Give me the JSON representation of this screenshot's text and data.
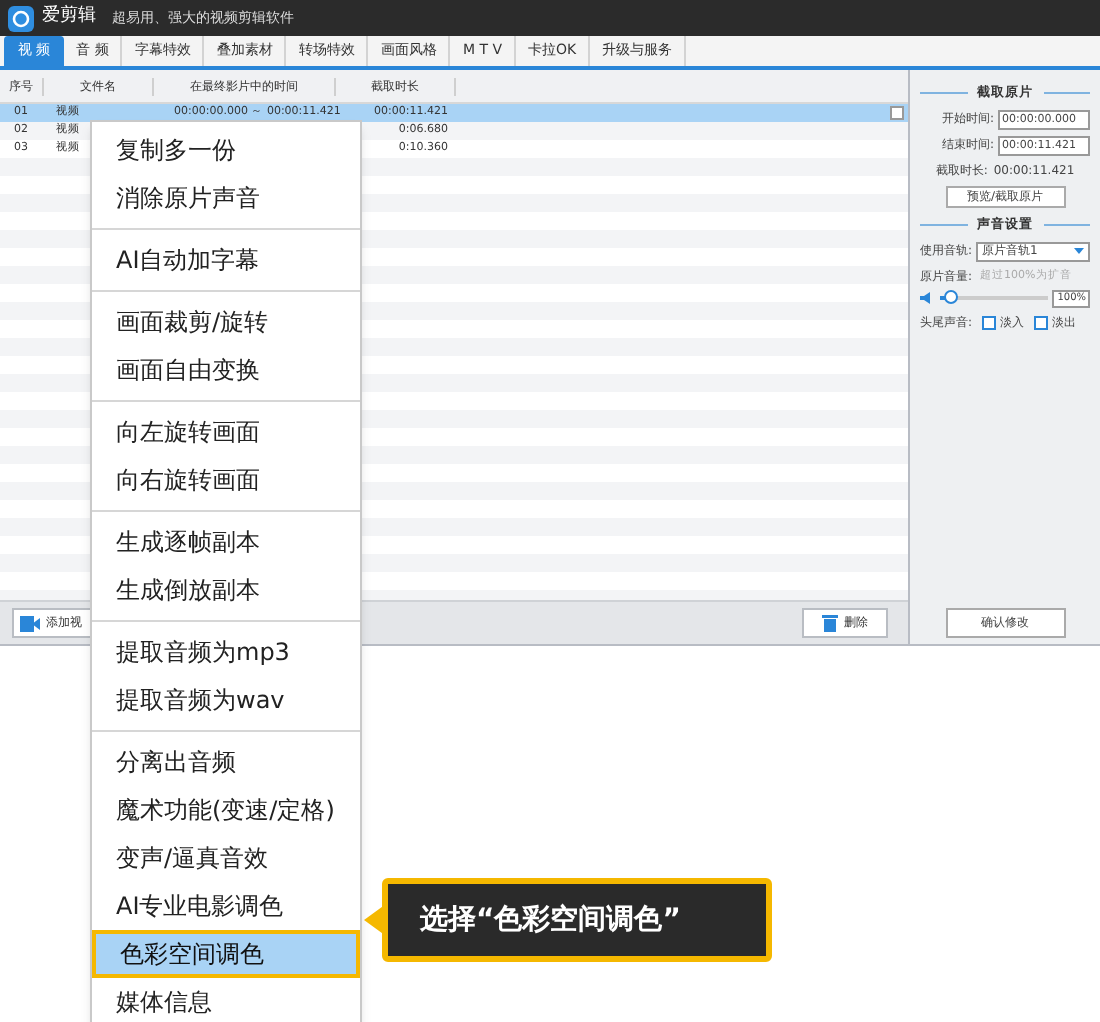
{
  "window": {
    "app_name": "爱剪辑",
    "tagline": "超易用、强大的视频剪辑软件"
  },
  "tabs": [
    {
      "label": "视 频",
      "selected": true
    },
    {
      "label": "音 频",
      "selected": false
    },
    {
      "label": "字幕特效",
      "selected": false
    },
    {
      "label": "叠加素材",
      "selected": false
    },
    {
      "label": "转场特效",
      "selected": false
    },
    {
      "label": "画面风格",
      "selected": false
    },
    {
      "label": "M T V",
      "selected": false
    },
    {
      "label": "卡拉OK",
      "selected": false
    },
    {
      "label": "升级与服务",
      "selected": false
    }
  ],
  "table": {
    "columns": [
      "序号",
      "文件名",
      "在最终影片中的时间",
      "截取时长"
    ],
    "rows": [
      {
        "cells": [
          "01",
          "视频",
          "00:00:00.000 ～ 00:00:11.421",
          "00:00:11.421"
        ],
        "selected": true
      },
      {
        "cells": [
          "02",
          "视频",
          "",
          "0:06.680"
        ],
        "selected": false
      },
      {
        "cells": [
          "03",
          "视频",
          "",
          "0:10.360"
        ],
        "selected": false
      }
    ]
  },
  "bottom_bar": {
    "add_button": "添加视",
    "delete_button": "删除"
  },
  "side_panel": {
    "clip_heading": "截取原片",
    "start_label": "开始时间:",
    "start_value": "00:00:00.000",
    "end_label": "结束时间:",
    "end_value": "00:00:11.421",
    "duration_label": "截取时长:",
    "duration_value": "00:00:11.421",
    "preview_button": "预览/截取原片",
    "sound_heading": "声音设置",
    "track_label": "使用音轨:",
    "track_value": "原片音轨1",
    "volume_label": "原片音量:",
    "volume_hint": "超过100%为扩音",
    "volume": {
      "level": 0.1,
      "reading": "100%"
    },
    "fade_label": "头尾声音:",
    "fade_in": {
      "label": "淡入",
      "checked": false
    },
    "fade_out": {
      "label": "淡出",
      "checked": false
    },
    "confirm_button": "确认修改"
  },
  "context_menu": {
    "groups": [
      [
        {
          "label": "复制多一份",
          "selected": false
        },
        {
          "label": "消除原片声音",
          "selected": false
        }
      ],
      [
        {
          "label": "AI自动加字幕",
          "selected": false
        }
      ],
      [
        {
          "label": "画面裁剪/旋转",
          "selected": false
        },
        {
          "label": "画面自由变换",
          "selected": false
        }
      ],
      [
        {
          "label": "向左旋转画面",
          "selected": false
        },
        {
          "label": "向右旋转画面",
          "selected": false
        }
      ],
      [
        {
          "label": "生成逐帧副本",
          "selected": false
        },
        {
          "label": "生成倒放副本",
          "selected": false
        }
      ],
      [
        {
          "label": "提取音频为mp3",
          "selected": false
        },
        {
          "label": "提取音频为wav",
          "selected": false
        }
      ],
      [
        {
          "label": "分离出音频",
          "selected": false
        },
        {
          "label": "魔术功能(变速/定格)",
          "selected": false
        },
        {
          "label": "变声/逼真音效",
          "selected": false
        },
        {
          "label": "AI专业电影调色",
          "selected": false
        },
        {
          "label": "色彩空间调色",
          "selected": true
        },
        {
          "label": "媒体信息",
          "selected": false
        }
      ]
    ]
  },
  "callout": "选择“色彩空间调色”"
}
